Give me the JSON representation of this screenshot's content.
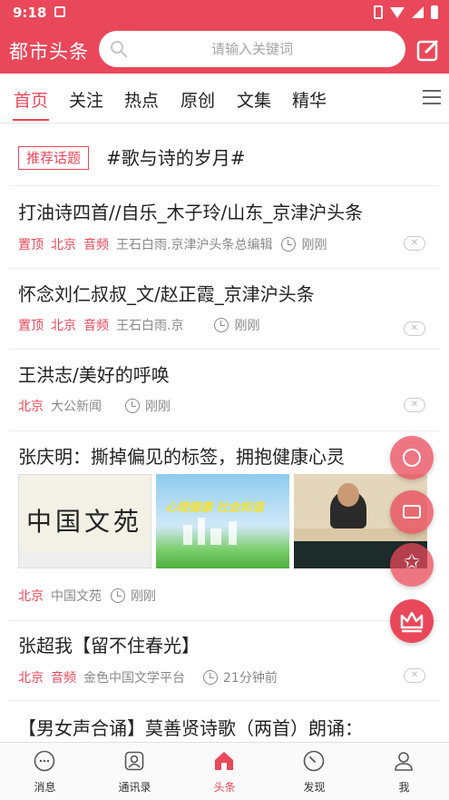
{
  "status_bar": {
    "time": "9:18"
  },
  "header": {
    "app_title": "都市头条",
    "search_placeholder": "请输入关键词"
  },
  "tabs": [
    {
      "label": "首页",
      "active": true
    },
    {
      "label": "关注",
      "active": false
    },
    {
      "label": "热点",
      "active": false
    },
    {
      "label": "原创",
      "active": false
    },
    {
      "label": "文集",
      "active": false
    },
    {
      "label": "精华",
      "active": false
    }
  ],
  "topic": {
    "tag": "推荐话题",
    "title": "#歌与诗的岁月#"
  },
  "feed": [
    {
      "title": "打油诗四首//自乐_木子玲/山东_京津沪头条",
      "tags": [
        "置顶",
        "北京",
        "音频"
      ],
      "source": "王石白雨.京津沪头条总编辑",
      "time": "刚刚"
    },
    {
      "title": "怀念刘仁叔叔_文/赵正霞_京津沪头条",
      "tags": [
        "置顶",
        "北京",
        "音频"
      ],
      "source": "王石白雨.京",
      "time": "刚刚"
    },
    {
      "title": "王洪志/美好的呼唤",
      "tags": [
        "北京"
      ],
      "source": "大公新闻",
      "time": "刚刚"
    },
    {
      "title": "张庆明：撕掉偏见的标签，拥抱健康心灵",
      "tags": [
        "北京"
      ],
      "source": "中国文苑",
      "time": "刚刚",
      "thumbnails": [
        {
          "text": "中国文苑"
        },
        {
          "text": "心理健康 社会和谐"
        },
        {
          "text": ""
        }
      ]
    },
    {
      "title": "张超我【留不住春光】",
      "tags": [
        "北京",
        "音频"
      ],
      "source": "金色中国文学平台",
      "time": "21分钟前"
    },
    {
      "title": "【男女声合诵】莫善贤诗歌（两首）朗诵：",
      "tags": [],
      "source": "",
      "time": ""
    }
  ],
  "bottom_nav": [
    {
      "label": "消息",
      "icon": "chat-icon"
    },
    {
      "label": "通讯录",
      "icon": "contacts-icon"
    },
    {
      "label": "头条",
      "icon": "home-icon",
      "active": true
    },
    {
      "label": "发现",
      "icon": "compass-icon"
    },
    {
      "label": "我",
      "icon": "user-icon"
    }
  ],
  "colors": {
    "brand": "#e8485a",
    "text": "#222222",
    "meta": "#888888"
  }
}
